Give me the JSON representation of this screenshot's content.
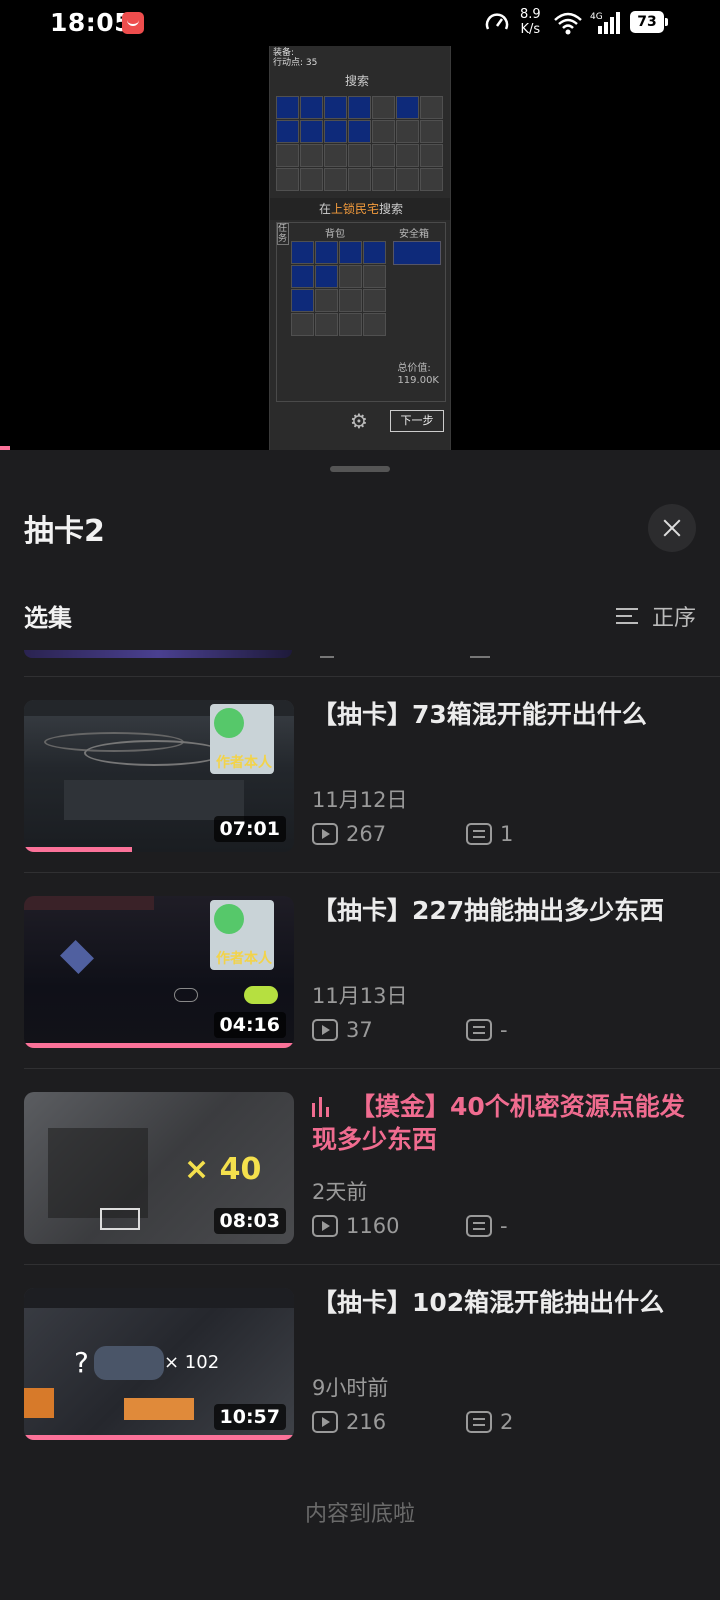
{
  "status_bar": {
    "time": "18:05",
    "net_speed_value": "8.9",
    "net_speed_unit": "K/s",
    "network": "4G",
    "battery": "73"
  },
  "game": {
    "header_line1": "装备:",
    "header_line2": "行动点: 35",
    "search_label": "搜索",
    "location_prefix": "在",
    "location_highlight": "上锁民宅",
    "location_suffix": "搜索",
    "tab_task": "任务",
    "tab_backpack": "背包",
    "tab_safebox": "安全箱",
    "total_label": "总价值:",
    "total_value": "119.00K",
    "next_button": "下一步"
  },
  "sheet": {
    "title": "抽卡2",
    "section_label": "选集",
    "order_label": "正序",
    "end_text": "内容到底啦"
  },
  "episodes": [
    {
      "title": "【抽卡】73箱混开能开出什么",
      "date": "11月12日",
      "plays": "267",
      "comments": "1",
      "duration": "07:01",
      "progress": 0.4,
      "active": false,
      "thumb_caption": "作者本人"
    },
    {
      "title": "【抽卡】227抽能抽出多少东西",
      "date": "11月13日",
      "plays": "37",
      "comments": "-",
      "duration": "04:16",
      "progress": 1.0,
      "active": false,
      "thumb_caption": "作者本人"
    },
    {
      "title": "【摸金】40个机密资源点能发现多少东西",
      "date": "2天前",
      "plays": "1160",
      "comments": "-",
      "duration": "08:03",
      "progress": 0,
      "active": true,
      "thumb_caption": "× 40"
    },
    {
      "title": "【抽卡】102箱混开能抽出什么",
      "date": "9小时前",
      "plays": "216",
      "comments": "2",
      "duration": "10:57",
      "progress": 1.0,
      "active": false,
      "thumb_caption": "× 102"
    }
  ],
  "colors": {
    "accent": "#fb7299",
    "active_title": "#f06c90",
    "sheet_bg": "#1d1d1f"
  }
}
